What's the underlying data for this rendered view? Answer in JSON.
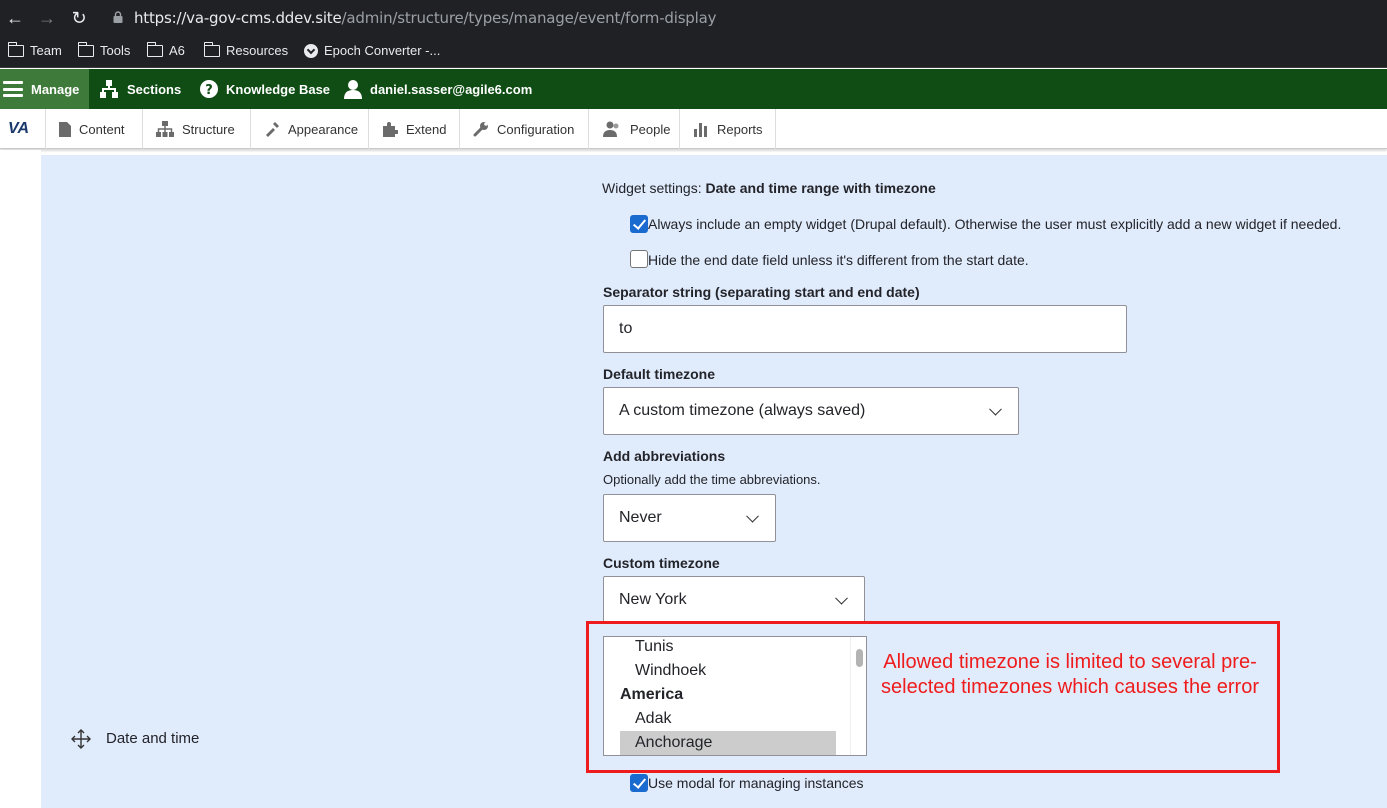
{
  "browser": {
    "url_host": "https://va-gov-cms.ddev.site",
    "url_path": "/admin/structure/types/manage/event/form-display",
    "bookmarks": [
      {
        "label": "Team",
        "icon": "folder-icon"
      },
      {
        "label": "Tools",
        "icon": "folder-icon"
      },
      {
        "label": "A6",
        "icon": "folder-icon"
      },
      {
        "label": "Resources",
        "icon": "folder-icon"
      },
      {
        "label": "Epoch Converter -...",
        "icon": "clock-icon"
      }
    ]
  },
  "toolbar": {
    "manage": "Manage",
    "sections": "Sections",
    "knowledge_base": "Knowledge Base",
    "user": "daniel.sasser@agile6.com"
  },
  "tray": {
    "logo": "VA",
    "items": [
      "Content",
      "Structure",
      "Appearance",
      "Extend",
      "Configuration",
      "People",
      "Reports"
    ]
  },
  "widget": {
    "settings_prefix": "Widget settings: ",
    "settings_name": "Date and time range with timezone",
    "empty_widget_label": "Always include an empty widget (Drupal default). Otherwise the user must explicitly add a new widget if needed.",
    "empty_widget_checked": true,
    "hide_end_label": "Hide the end date field unless it's different from the start date.",
    "hide_end_checked": false,
    "separator_label": "Separator string (separating start and end date)",
    "separator_value": "to",
    "default_tz_label": "Default timezone",
    "default_tz_value": "A custom timezone (always saved)",
    "abbr_label": "Add abbreviations",
    "abbr_desc": "Optionally add the time abbreviations.",
    "abbr_value": "Never",
    "custom_tz_label": "Custom timezone",
    "custom_tz_value": "New York",
    "tz_list": [
      {
        "label": "Tunis",
        "type": "option"
      },
      {
        "label": "Windhoek",
        "type": "option"
      },
      {
        "label": "America",
        "type": "group"
      },
      {
        "label": "Adak",
        "type": "option"
      },
      {
        "label": "Anchorage",
        "type": "selected"
      }
    ],
    "modal_label": "Use modal for managing instances",
    "modal_checked": true
  },
  "annotation": {
    "text": "Allowed timezone is limited to several pre-selected timezones which causes the error",
    "color": "#ee1c1c"
  },
  "row": {
    "label": "Date and time"
  },
  "colors": {
    "toolbar_bg": "#0f4d14",
    "content_bg": "#e0ebfc",
    "accent": "#1a6bd0"
  }
}
